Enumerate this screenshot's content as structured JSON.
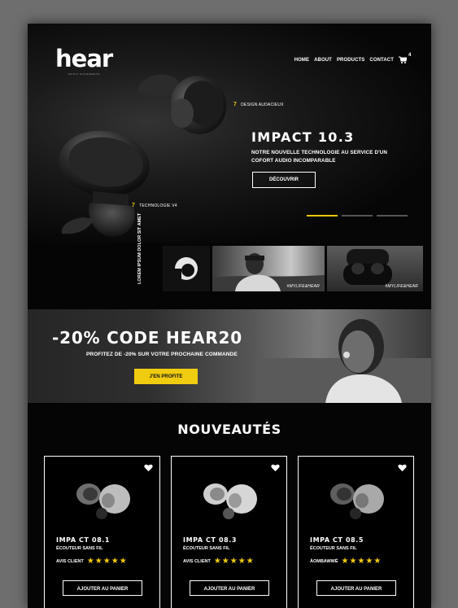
{
  "brand": {
    "logo": "hear",
    "tagline": "MUSIC DIFFERENTE"
  },
  "nav": {
    "items": [
      "HOME",
      "ABOUT",
      "PRODUCTS",
      "CONTACT"
    ],
    "cart_badge": "4"
  },
  "hero": {
    "callout_top": {
      "num": "7",
      "label": "DESIGN AUDACIEUX"
    },
    "callout_bottom": {
      "num": "7",
      "label": "TECHNOLOGIE V4"
    },
    "title": "IMPACT 10.3",
    "subtitle": "NOTRE NOUVELLE TECHNOLOGIE AU SERVICE D'UN COFORT AUDIO INCOMPARABLE",
    "cta": "DÉCOUVRIR",
    "slides_total": 3,
    "active_slide": 1
  },
  "gallery": {
    "vertical_text": "LOREM IPSUM DOLOR SIT AMET",
    "tiles": [
      {
        "type": "logo"
      },
      {
        "type": "photo",
        "tag": "#MYLIFE&HEAR"
      },
      {
        "type": "photo",
        "tag": "#MYLIFE&HEAR"
      }
    ]
  },
  "promo": {
    "title": "-20% CODE HEAR20",
    "subtitle": "PROFITEZ DE -20% SUR VOTRE PROCHAINE COMMANDE",
    "cta": "J'EN PROFITE"
  },
  "products": {
    "section_title": "NOUVEAUTÉS",
    "items": [
      {
        "name": "IMPA CT 08.1",
        "desc": "ÉCOUTEUR SANS FIL",
        "rating_label": "AVIS CLIENT",
        "stars": 5,
        "cta": "AJOUTER AU PANIER"
      },
      {
        "name": "IMPA CT 08.3",
        "desc": "ÉCOUTEUR SANS FIL",
        "rating_label": "AVIS CLIENT",
        "stars": 5,
        "cta": "AJOUTER AU PANIER"
      },
      {
        "name": "IMPA CT 08.5",
        "desc": "ÉCOUTEUR SANS FIL",
        "rating_label": "ÀOMBAWWÉ",
        "stars": 5,
        "cta": "AJOUTER AU PANIER"
      }
    ]
  },
  "colors": {
    "accent": "#f0cc10",
    "background": "#050505",
    "frame": "#6e6e6e"
  }
}
